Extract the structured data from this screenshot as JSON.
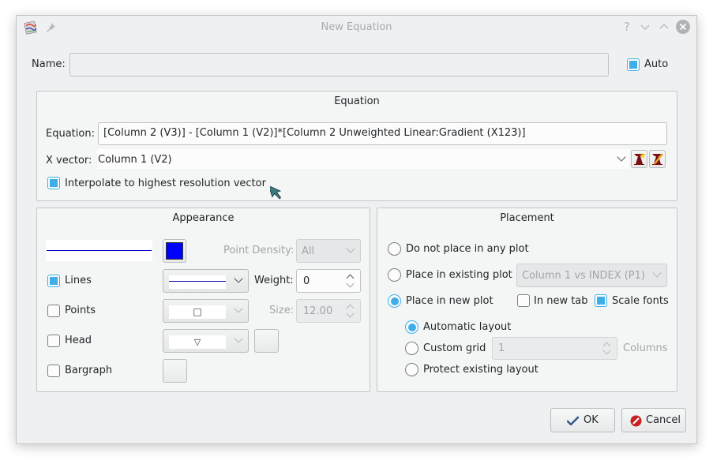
{
  "window": {
    "title": "New Equation",
    "titlebar_buttons": [
      "help-icon",
      "minimize-icon",
      "maximize-icon",
      "close-icon"
    ]
  },
  "name": {
    "label": "Name:",
    "value": "",
    "auto_label": "Auto",
    "auto_checked": true
  },
  "equation_group": {
    "title": "Equation",
    "equation_label": "Equation:",
    "equation_value": "[Column 2 (V3)] - [Column 1 (V2)]*[Column 2 Unweighted Linear:Gradient (X123)]",
    "xvector_label": "X vector:",
    "xvector_value": "Column 1 (V2)",
    "new_vector_icon": "new-vector-icon",
    "edit_vector_icon": "edit-vector-icon",
    "interpolate_label": "Interpolate to highest resolution vector",
    "interpolate_checked": true
  },
  "appearance": {
    "title": "Appearance",
    "line_color": "#0000ff",
    "point_density_label": "Point Density:",
    "point_density_value": "All",
    "lines_label": "Lines",
    "lines_checked": true,
    "weight_label": "Weight:",
    "weight_value": "0",
    "points_label": "Points",
    "points_checked": false,
    "point_symbol": "□",
    "size_label": "Size:",
    "size_value": "12.00",
    "head_label": "Head",
    "head_checked": false,
    "head_symbol": "▽",
    "bargraph_label": "Bargraph",
    "bargraph_checked": false
  },
  "placement": {
    "title": "Placement",
    "options": [
      {
        "label": "Do not place in any plot",
        "checked": false
      },
      {
        "label": "Place in existing plot",
        "checked": false
      },
      {
        "label": "Place in new plot",
        "checked": true
      }
    ],
    "existing_plot_value": "Column 1 vs INDEX (P1)",
    "in_new_tab_label": "In new tab",
    "in_new_tab_checked": false,
    "scale_fonts_label": "Scale fonts",
    "scale_fonts_checked": true,
    "layout_options": [
      {
        "label": "Automatic layout",
        "checked": true
      },
      {
        "label": "Custom grid",
        "checked": false
      },
      {
        "label": "Protect existing layout",
        "checked": false
      }
    ],
    "columns_value": "1",
    "columns_label": "Columns"
  },
  "buttons": {
    "ok_label": "OK",
    "cancel_label": "Cancel"
  }
}
